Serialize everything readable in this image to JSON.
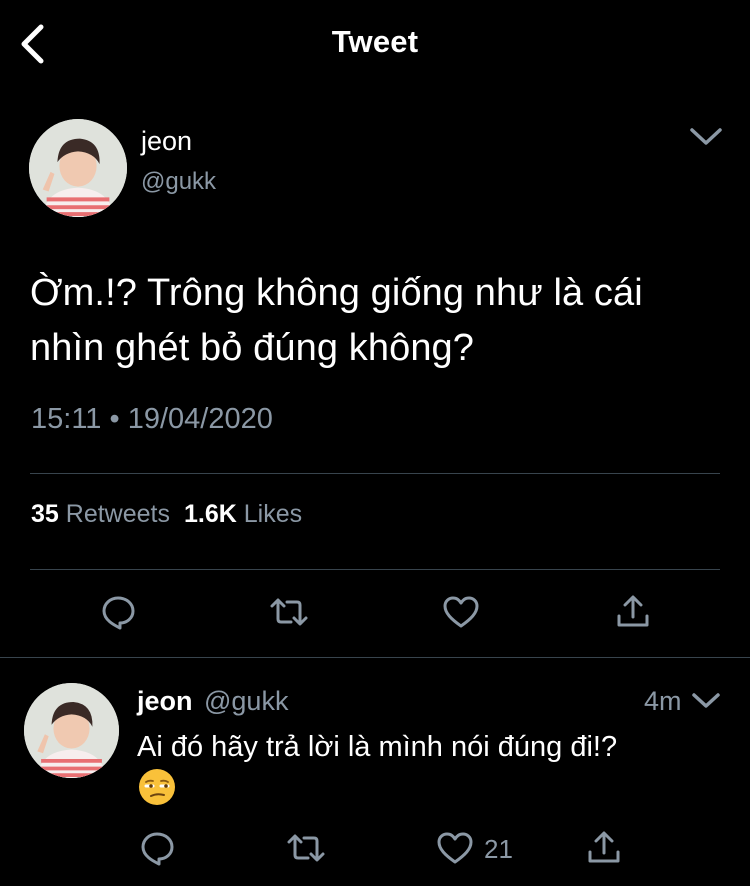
{
  "header": {
    "title": "Tweet"
  },
  "tweet": {
    "author_name": "jeon",
    "author_handle": "@gukk",
    "text_line1": "Ờm.!? Trông không giống như là cái",
    "text_line2": "nhìn ghét bỏ đúng không?",
    "time": "15:11",
    "separator": "•",
    "date": "19/04/2020",
    "retweet_count": "35",
    "retweet_label": "Retweets",
    "like_count": "1.6K",
    "like_label": "Likes"
  },
  "reply": {
    "author_name": "jeon",
    "author_handle": "@gukk",
    "timestamp": "4m",
    "text": "Ai đó hãy trả lời là mình nói đúng đi!?",
    "emoji": "unamused-face",
    "like_count": "21"
  },
  "icons": {
    "back": "chevron-left-icon",
    "menu": "chevron-down-icon",
    "reply": "comment-bubble-icon",
    "retweet": "retweet-arrows-icon",
    "like": "heart-outline-icon",
    "share": "share-upload-icon"
  },
  "colors": {
    "background": "#000000",
    "primary_text": "#ffffff",
    "secondary_text": "#8b98a5",
    "divider": "#38444d",
    "icon": "#8b98a5"
  }
}
